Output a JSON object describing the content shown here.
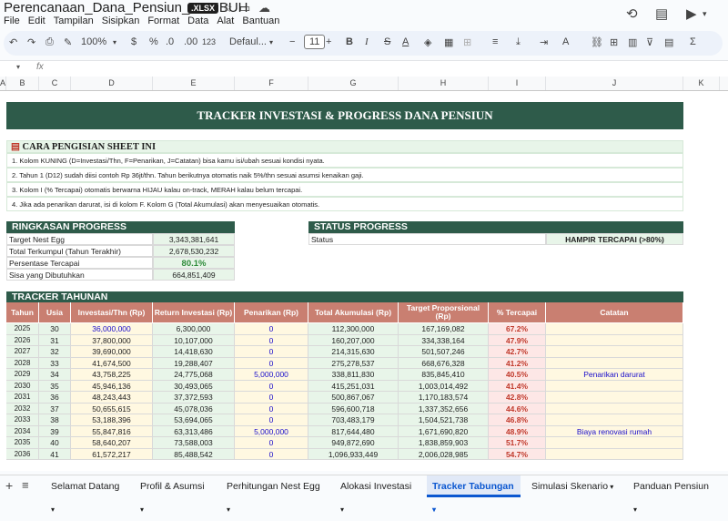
{
  "doc": {
    "title": "Perencanaan_Dana_Pensiun_TUMBUH",
    "badge": ".XLSX"
  },
  "menu": [
    "File",
    "Edit",
    "Tampilan",
    "Sisipkan",
    "Format",
    "Data",
    "Alat",
    "Bantuan"
  ],
  "toolbar": {
    "zoom": "100%",
    "currency": "$",
    "percent": "%",
    "dec_less": ".0",
    "dec_more": ".00",
    "number_format": "123",
    "font": "Defaul...",
    "font_size": "11"
  },
  "formula": {
    "cell_ref": "",
    "fx": "fx"
  },
  "columns": [
    "A",
    "B",
    "C",
    "D",
    "E",
    "F",
    "G",
    "H",
    "I",
    "J",
    "K"
  ],
  "banner": "TRACKER INVESTASI & PROGRESS DANA PENSIUN",
  "instructions": {
    "title": "CARA PENGISIAN SHEET INI",
    "items": [
      "1. Kolom KUNING (D=Investasi/Thn, F=Penarikan, J=Catatan) bisa kamu isi/ubah sesuai kondisi nyata.",
      "2. Tahun 1 (D12) sudah diisi contoh Rp 36jt/thn. Tahun berikutnya otomatis naik 5%/thn sesuai asumsi kenaikan gaji.",
      "3. Kolom I (% Tercapai) otomatis berwarna HIJAU kalau on-track, MERAH kalau belum tercapai.",
      "4. Jika ada penarikan darurat, isi di kolom F. Kolom G (Total Akumulasi) akan menyesuaikan otomatis."
    ]
  },
  "summary": {
    "title": "RINGKASAN PROGRESS",
    "rows": [
      {
        "label": "Target Nest Egg",
        "value": "3,343,381,641"
      },
      {
        "label": "Total Terkumpul (Tahun Terakhir)",
        "value": "2,678,530,232"
      },
      {
        "label": "Persentase Tercapai",
        "value": "80.1%"
      },
      {
        "label": "Sisa yang Dibutuhkan",
        "value": "664,851,409"
      }
    ]
  },
  "status": {
    "title": "STATUS PROGRESS",
    "label": "Status",
    "value": "HAMPIR TERCAPAI (>80%)"
  },
  "tracker": {
    "title": "TRACKER TAHUNAN",
    "headers": [
      "Tahun",
      "Usia",
      "Investasi/Thn (Rp)",
      "Return Investasi (Rp)",
      "Penarikan (Rp)",
      "Total Akumulasi (Rp)",
      "Target Proporsional (Rp)",
      "% Tercapai",
      "Catatan"
    ],
    "rows": [
      [
        "2025",
        "30",
        "36,000,000",
        "6,300,000",
        "0",
        "112,300,000",
        "167,169,082",
        "67.2%",
        ""
      ],
      [
        "2026",
        "31",
        "37,800,000",
        "10,107,000",
        "0",
        "160,207,000",
        "334,338,164",
        "47.9%",
        ""
      ],
      [
        "2027",
        "32",
        "39,690,000",
        "14,418,630",
        "0",
        "214,315,630",
        "501,507,246",
        "42.7%",
        ""
      ],
      [
        "2028",
        "33",
        "41,674,500",
        "19,288,407",
        "0",
        "275,278,537",
        "668,676,328",
        "41.2%",
        ""
      ],
      [
        "2029",
        "34",
        "43,758,225",
        "24,775,068",
        "5,000,000",
        "338,811,830",
        "835,845,410",
        "40.5%",
        "Penarikan darurat"
      ],
      [
        "2030",
        "35",
        "45,946,136",
        "30,493,065",
        "0",
        "415,251,031",
        "1,003,014,492",
        "41.4%",
        ""
      ],
      [
        "2031",
        "36",
        "48,243,443",
        "37,372,593",
        "0",
        "500,867,067",
        "1,170,183,574",
        "42.8%",
        ""
      ],
      [
        "2032",
        "37",
        "50,655,615",
        "45,078,036",
        "0",
        "596,600,718",
        "1,337,352,656",
        "44.6%",
        ""
      ],
      [
        "2033",
        "38",
        "53,188,396",
        "53,694,065",
        "0",
        "703,483,179",
        "1,504,521,738",
        "46.8%",
        ""
      ],
      [
        "2034",
        "39",
        "55,847,816",
        "63,313,486",
        "5,000,000",
        "817,644,480",
        "1,671,690,820",
        "48.9%",
        "Biaya renovasi rumah"
      ],
      [
        "2035",
        "40",
        "58,640,207",
        "73,588,003",
        "0",
        "949,872,690",
        "1,838,859,903",
        "51.7%",
        ""
      ],
      [
        "2036",
        "41",
        "61,572,217",
        "85,488,542",
        "0",
        "1,096,933,449",
        "2,006,028,985",
        "54.7%",
        ""
      ]
    ]
  },
  "tabs": [
    {
      "label": "Selamat Datang",
      "active": false
    },
    {
      "label": "Profil & Asumsi",
      "active": false
    },
    {
      "label": "Perhitungan Nest Egg",
      "active": false
    },
    {
      "label": "Alokasi Investasi",
      "active": false
    },
    {
      "label": "Tracker Tabungan",
      "active": true
    },
    {
      "label": "Simulasi Skenario",
      "active": false
    },
    {
      "label": "Panduan Pensiun",
      "active": false
    }
  ],
  "colors": {
    "dark_green": "#2e5b4a",
    "header_red": "#c97f71",
    "active_tab": "#0b57d0",
    "light_green": "#e8f5e9",
    "light_yellow": "#fff8e1",
    "light_red": "#fde7e6"
  }
}
